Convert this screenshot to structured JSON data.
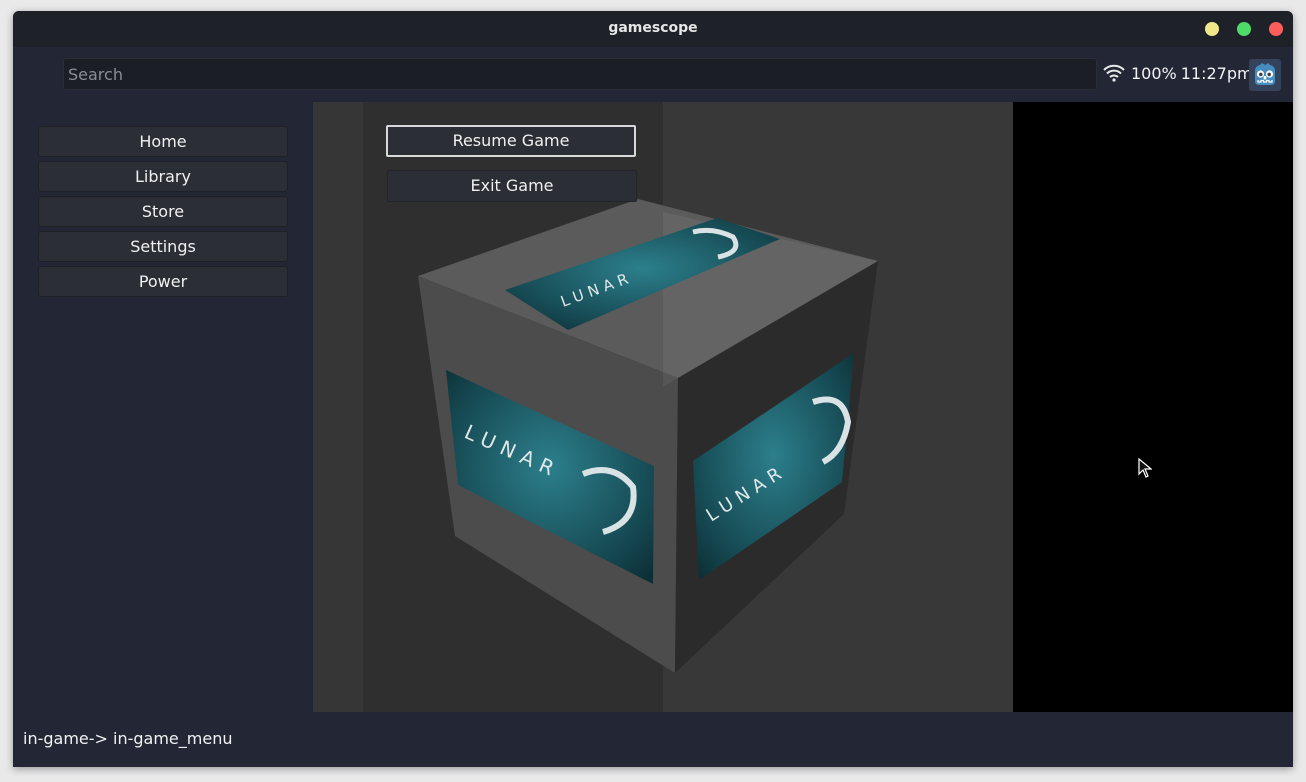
{
  "window": {
    "title": "gamescope"
  },
  "topbar": {
    "search_placeholder": "Search",
    "battery": "100%",
    "time": "11:27pm",
    "wifi_icon": "wifi-icon",
    "avatar_icon": "godot-robot-icon"
  },
  "sidebar": {
    "items": [
      {
        "label": "Home"
      },
      {
        "label": "Library"
      },
      {
        "label": "Store"
      },
      {
        "label": "Settings"
      },
      {
        "label": "Power"
      }
    ]
  },
  "game_menu": {
    "resume_label": "Resume Game",
    "exit_label": "Exit Game"
  },
  "game": {
    "logo_text": "LUNAR G"
  },
  "statusbar": {
    "state": "in-game-> in-game_menu"
  },
  "colors": {
    "background": "#232735",
    "titlebar": "#1f2128",
    "button": "#2c2e35",
    "close": "#ff5c5c",
    "maximize": "#4fdb6a",
    "minimize": "#f0e68a",
    "logo_teal": "#1e5964"
  }
}
